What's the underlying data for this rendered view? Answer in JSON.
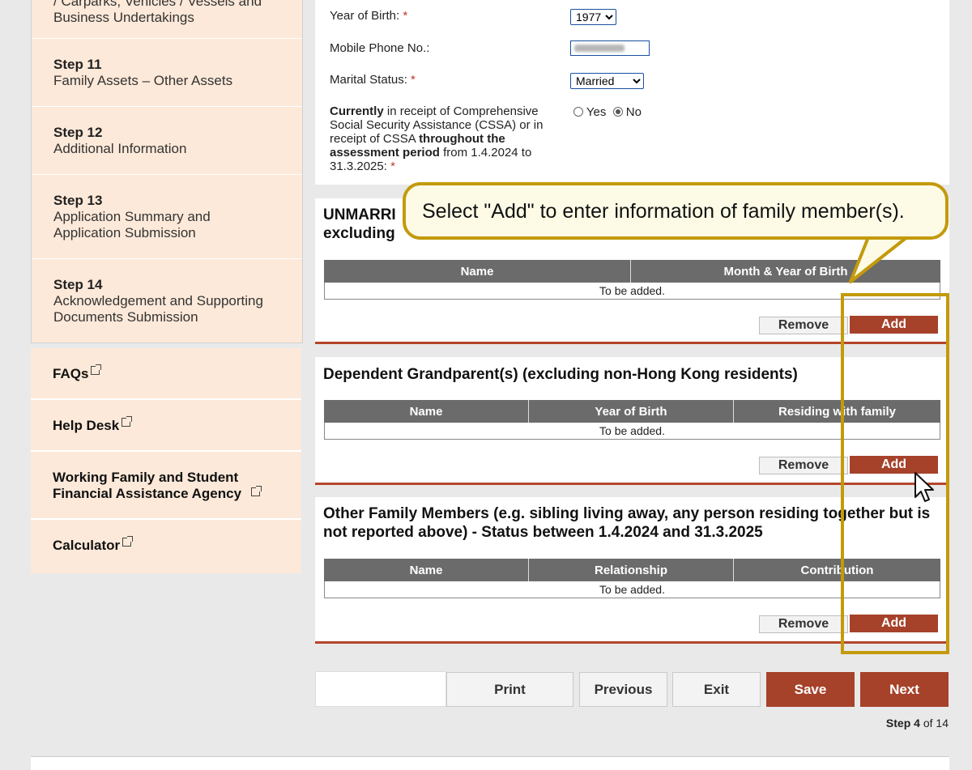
{
  "sidebar": {
    "partial_step_text": "/ Carparks, Vehicles / Vessels and Business Undertakings",
    "steps": [
      {
        "num": "Step 11",
        "label": "Family Assets – Other Assets"
      },
      {
        "num": "Step 12",
        "label": "Additional Information"
      },
      {
        "num": "Step 13",
        "label": "Application Summary and Application Submission"
      },
      {
        "num": "Step 14",
        "label": "Acknowledgement and Supporting Documents Submission"
      }
    ],
    "links": [
      {
        "label": "FAQs"
      },
      {
        "label": "Help Desk"
      },
      {
        "label": "Working Family and Student Financial Assistance Agency"
      },
      {
        "label": "Calculator"
      }
    ]
  },
  "form": {
    "year_of_birth_label": "Year of Birth:",
    "year_of_birth_value": "1977",
    "mobile_label": "Mobile Phone No.:",
    "marital_label": "Marital Status:",
    "marital_value": "Married",
    "required_mark": "*",
    "cssa_q_part1": "Currently",
    "cssa_q_part2": " in receipt of Comprehensive Social Security Assistance (CSSA) or in receipt of CSSA ",
    "cssa_q_part3": "throughout the assessment period",
    "cssa_q_part4": " from 1.4.2024 to 31.3.2025:",
    "cssa_yes": "Yes",
    "cssa_no": "No",
    "cssa_selected": "No"
  },
  "sections": [
    {
      "title": "UNMARRIED ... excluding ...",
      "title_line1": "UNMARRI",
      "title_line2": "excluding",
      "columns": [
        "Name",
        "Month & Year of Birth"
      ],
      "empty_text": "To be added.",
      "remove_label": "Remove",
      "add_label": "Add"
    },
    {
      "title": "Dependent Grandparent(s) (excluding non-Hong Kong residents)",
      "columns": [
        "Name",
        "Year of Birth",
        "Residing with family"
      ],
      "empty_text": "To be added.",
      "remove_label": "Remove",
      "add_label": "Add"
    },
    {
      "title": "Other Family Members (e.g. sibling living away, any person residing together but is not reported above) - Status between 1.4.2024 and 31.3.2025",
      "columns": [
        "Name",
        "Relationship",
        "Contribution"
      ],
      "empty_text": "To be added.",
      "remove_label": "Remove",
      "add_label": "Add"
    }
  ],
  "nav": {
    "print": "Print",
    "previous": "Previous",
    "exit": "Exit",
    "save": "Save",
    "next": "Next"
  },
  "progress": {
    "step_word": "Step",
    "current": "4",
    "of_word": "of",
    "total": "14"
  },
  "callout": {
    "text": "Select \"Add\" to enter information of family member(s)."
  },
  "colors": {
    "accent_red": "#a6422a",
    "sidebar_bg": "#fde9d9",
    "highlight_gold": "#c39a0b"
  }
}
